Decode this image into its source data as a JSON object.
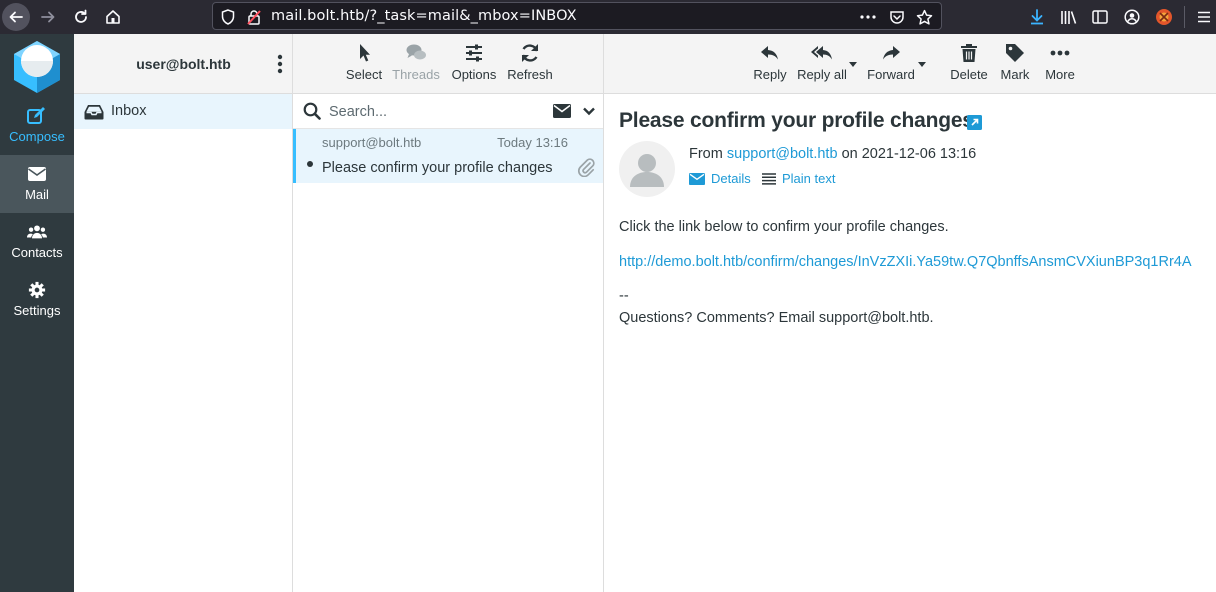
{
  "browser": {
    "url": "mail.bolt.htb/?_task=mail&_mbox=INBOX"
  },
  "rail": {
    "compose": "Compose",
    "mail": "Mail",
    "contacts": "Contacts",
    "settings": "Settings"
  },
  "folders": {
    "account": "user@bolt.htb",
    "inbox": "Inbox"
  },
  "list_toolbar": {
    "select": "Select",
    "threads": "Threads",
    "options": "Options",
    "refresh": "Refresh"
  },
  "search": {
    "placeholder": "Search..."
  },
  "messages": [
    {
      "from": "support@bolt.htb",
      "date": "Today 13:16",
      "subject": "Please confirm your profile changes"
    }
  ],
  "reader_toolbar": {
    "reply": "Reply",
    "reply_all": "Reply all",
    "forward": "Forward",
    "delete": "Delete",
    "mark": "Mark",
    "more": "More"
  },
  "message": {
    "subject": "Please confirm your profile changes",
    "from_prefix": "From",
    "from_address": "support@bolt.htb",
    "date_text": "on 2021-12-06 13:16",
    "details": "Details",
    "plain_text": "Plain text",
    "body_line1": "Click the link below to confirm your profile changes.",
    "body_link": "http://demo.bolt.htb/confirm/changes/InVzZXIi.Ya59tw.Q7QbnffsAnsmCVXiunBP3q1Rr4A",
    "body_dash": "--",
    "body_footer": "Questions? Comments? Email support@bolt.htb."
  },
  "colors": {
    "accent": "#37beff",
    "link": "#1e9ad6",
    "rail_bg": "#2f3a3f",
    "selected_bg": "#e8f5fd"
  }
}
